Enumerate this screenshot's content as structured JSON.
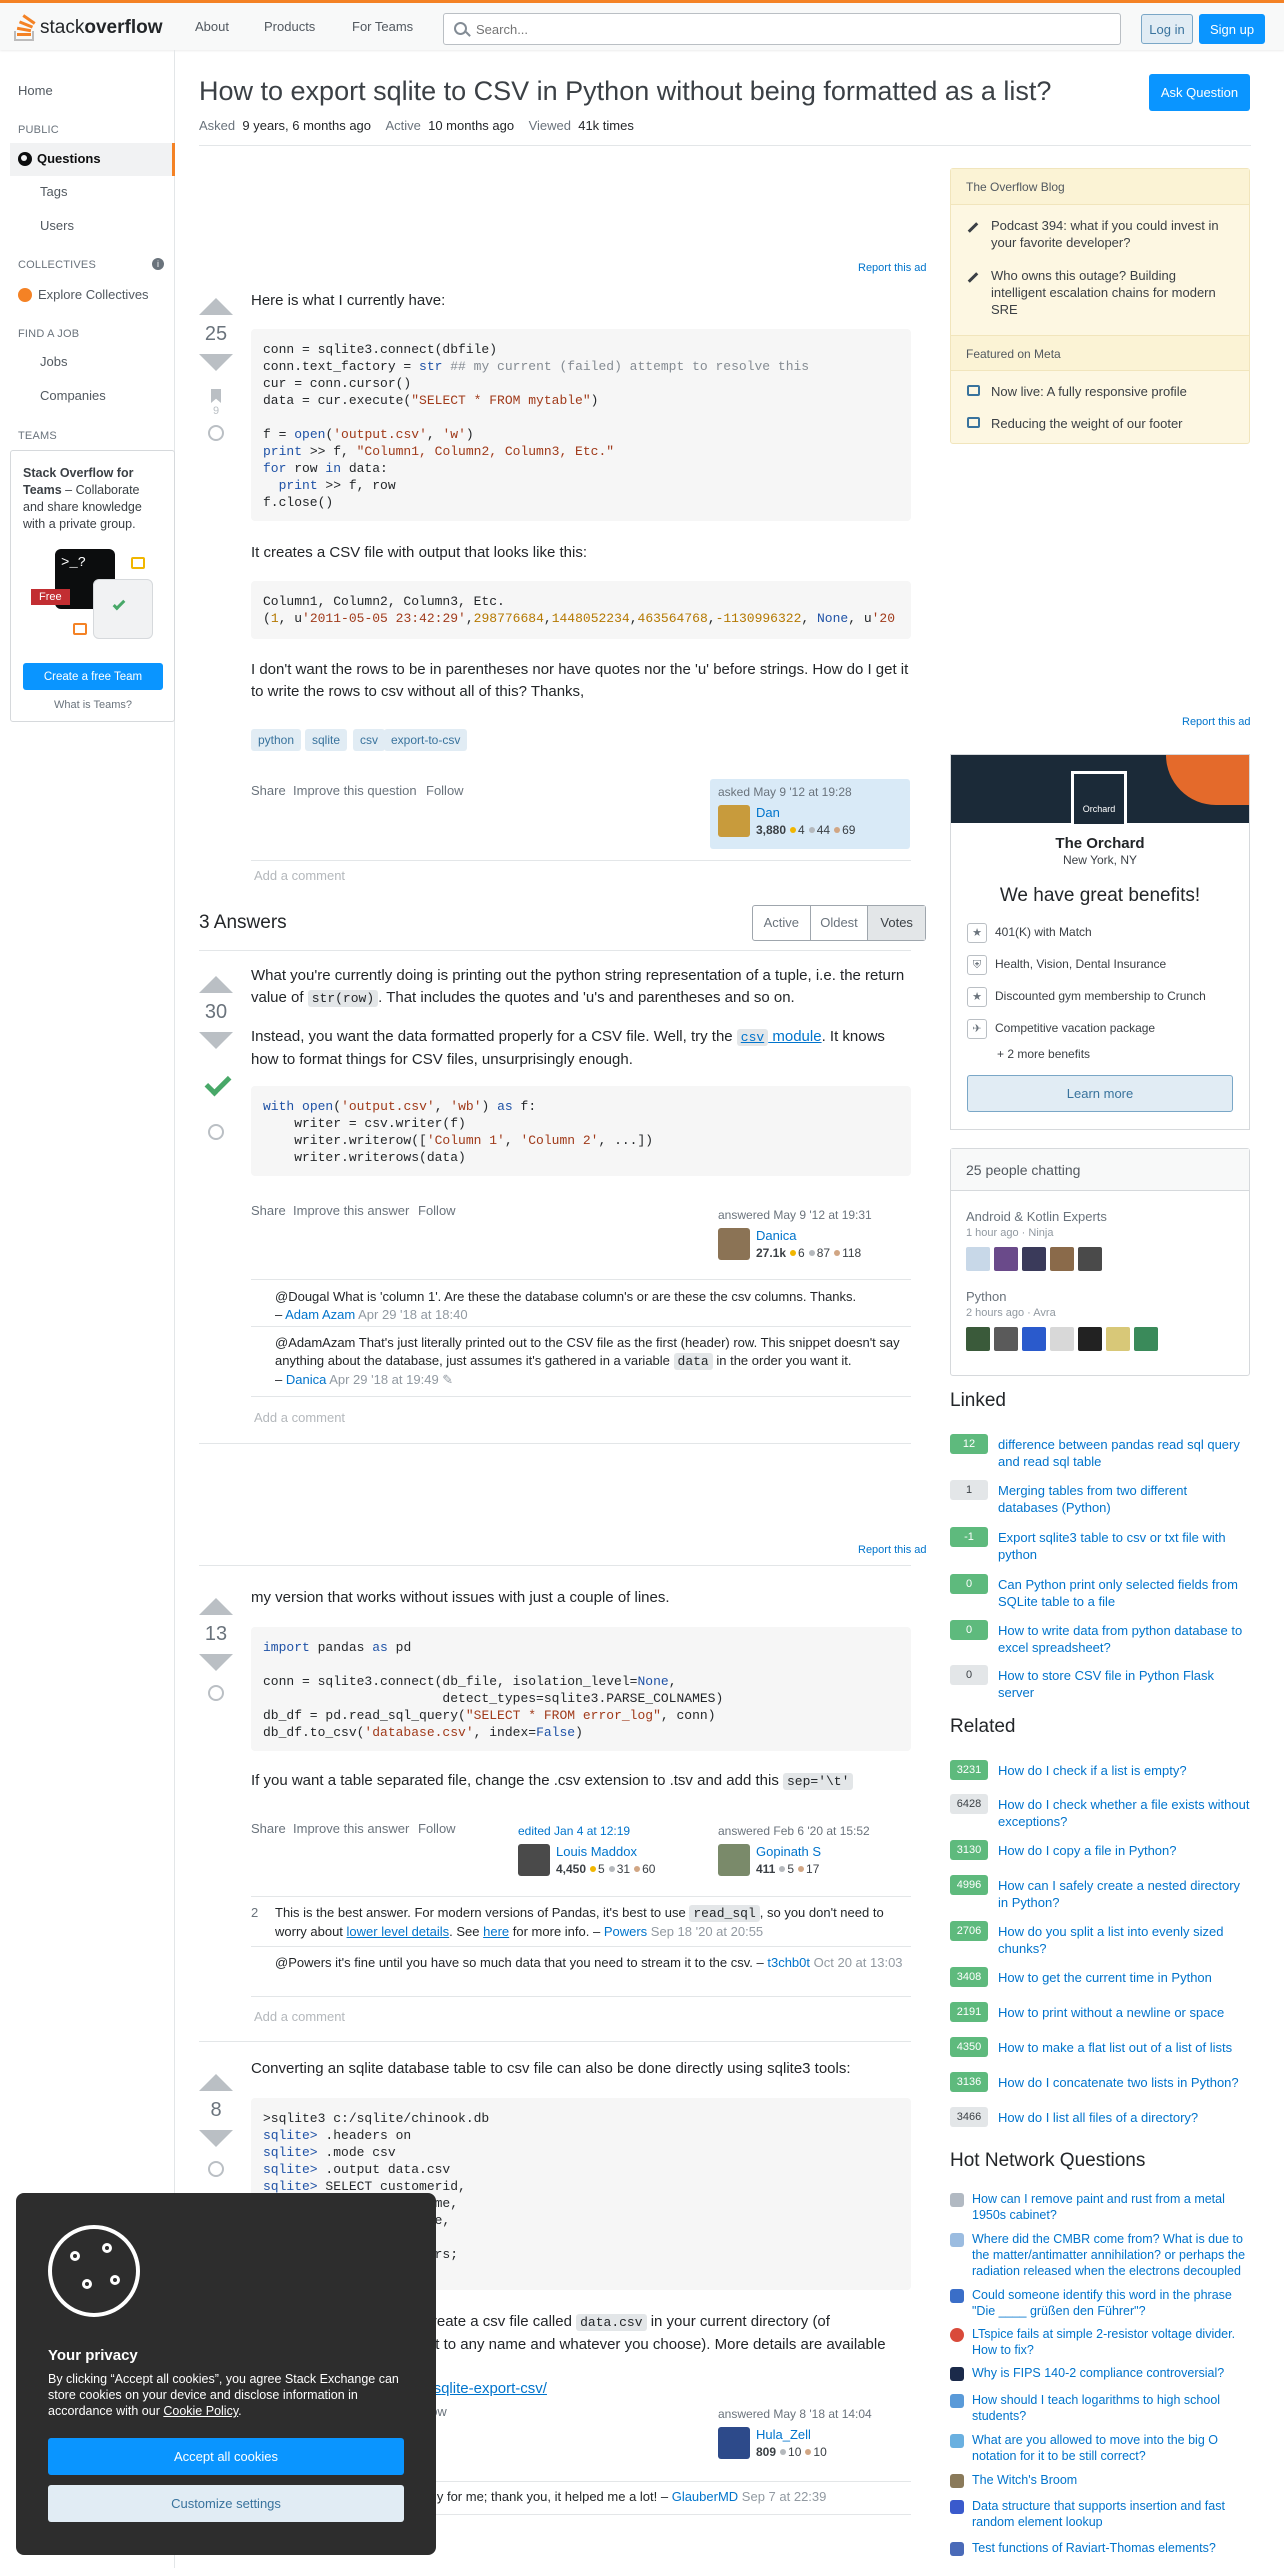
{
  "header": {
    "logo_text": "stack",
    "logo_bold": "overflow",
    "nav": [
      "About",
      "Products",
      "For Teams"
    ],
    "search_placeholder": "Search...",
    "login": "Log in",
    "signup": "Sign up"
  },
  "sidebar": {
    "home": "Home",
    "public": "PUBLIC",
    "questions": "Questions",
    "tags": "Tags",
    "users": "Users",
    "collectives": "COLLECTIVES",
    "explore": "Explore Collectives",
    "findajob": "FIND A JOB",
    "jobs": "Jobs",
    "companies": "Companies",
    "teams": "TEAMS",
    "teams_title": "Stack Overflow for Teams",
    "teams_desc": " – Collaborate and share knowledge with a private group.",
    "free": "Free",
    "create_team": "Create a free Team",
    "what_is": "What is Teams?"
  },
  "question": {
    "title": "How to export sqlite to CSV in Python without being formatted as a list?",
    "ask_button": "Ask Question",
    "asked_label": "Asked",
    "asked": "9 years, 6 months ago",
    "active_label": "Active",
    "active": "10 months ago",
    "viewed_label": "Viewed",
    "viewed": "41k times",
    "votes": "25",
    "bookmarks": "9",
    "intro": "Here is what I currently have:",
    "mid": "It creates a CSV file with output that looks like this:",
    "outro": "I don't want the rows to be in parentheses nor have quotes nor the 'u' before strings. How do I get it to write the rows to csv without all of this? Thanks,",
    "tags": [
      "python",
      "sqlite",
      "csv",
      "export-to-csv"
    ],
    "menu": [
      "Share",
      "Improve this question",
      "Follow"
    ],
    "asked_sig": "asked May 9 '12 at 19:28",
    "user": "Dan",
    "rep": "3,880",
    "gold": "4",
    "silver": "44",
    "bronze": "69",
    "add_comment": "Add a comment"
  },
  "report_ad": "Report this ad",
  "answers_header": "3 Answers",
  "sort": [
    "Active",
    "Oldest",
    "Votes"
  ],
  "a1": {
    "votes": "30",
    "p1a": "What you're currently doing is printing out the python string representation of a tuple, i.e. the return value of ",
    "p1code": "str(row)",
    "p1b": ". That includes the quotes and 'u's and parentheses and so on.",
    "p2a": "Instead, you want the data formatted properly for a CSV file. Well, try the ",
    "p2code": "csv",
    "p2link": " module",
    "p2b": ". It knows how to format things for CSV files, unsurprisingly enough.",
    "menu": [
      "Share",
      "Improve this answer",
      "Follow"
    ],
    "answered": "answered May 9 '12 at 19:31",
    "user": "Danica",
    "rep": "27.1k",
    "gold": "6",
    "silver": "87",
    "bronze": "118",
    "c1": "@Dougal What is 'column 1'. Are these the database column's or are these the csv columns. Thanks.",
    "c1u": "Adam Azam",
    "c1d": "Apr 29 '18 at 18:40",
    "c2a": "@AdamAzam That's just literally printed out to the CSV file as the first (header) row. This snippet doesn't say anything about the database, just assumes it's gathered in a variable ",
    "c2code": "data",
    "c2b": " in the order you want it.",
    "c2u": "Danica",
    "c2d": "Apr 29 '18 at 19:49",
    "add_comment": "Add a comment"
  },
  "a2": {
    "votes": "13",
    "p1": "my version that works without issues with just a couple of lines.",
    "p2a": "If you want a table separated file, change the .csv extension to .tsv and add this ",
    "p2code": "sep='\\t'",
    "menu": [
      "Share",
      "Improve this answer",
      "Follow"
    ],
    "edited": "edited Jan 4 at 12:19",
    "editor": "Louis Maddox",
    "erep": "4,450",
    "eg": "5",
    "es": "31",
    "eb": "60",
    "answered": "answered Feb 6 '20 at 15:52",
    "user": "Gopinath S",
    "rep": "411",
    "silver": "5",
    "bronze": "17",
    "c1score": "2",
    "c1a": "This is the best answer. For modern versions of Pandas, it's best to use ",
    "c1code": "read_sql",
    "c1b": ", so you don't need to worry about ",
    "c1link": "lower level details",
    "c1c": ". See ",
    "c1link2": "here",
    "c1d2": " for more info. – ",
    "c1u": "Powers",
    "c1d": "Sep 18 '20 at 20:55",
    "c2": "@Powers it's fine until you have so much data that you need to stream it to the csv. – ",
    "c2u": "t3chb0t",
    "c2d": "Oct 20 at 13:03",
    "add_comment": "Add a comment"
  },
  "a3": {
    "votes": "8",
    "p1": "Converting an sqlite database table to csv file can also be done directly using sqlite3 tools:",
    "p2a": "s will will create a csv file called ",
    "p2code": "data.csv",
    "p2b": " in your current directory (of",
    "p2c": "d whatever you choose). More details are available here:",
    "p2link": "qlite-export-csv/",
    "menu": "ow",
    "answered": "answered May 8 '18 at 14:04",
    "user": "Hula_Zell",
    "rep": "809",
    "silver": "10",
    "bronze": "10",
    "c1": "me; thank you, it helped me a lot! – ",
    "c1u": "GlauberMD",
    "c1d": "Sep 7 at 22:39"
  },
  "blog": {
    "header": "The Overflow Blog",
    "i1": "Podcast 394: what if you could invest in your favorite developer?",
    "i2": "Who owns this outage? Building intelligent escalation chains for modern SRE",
    "meta": "Featured on Meta",
    "m1": "Now live: A fully responsive profile",
    "m2": "Reducing the weight of our footer"
  },
  "ad": {
    "logo": "Orchard",
    "company": "The Orchard",
    "location": "New York, NY",
    "headline": "We have great benefits!",
    "benefits": [
      "401(K) with Match",
      "Health, Vision, Dental Insurance",
      "Discounted gym membership to Crunch",
      "Competitive vacation package"
    ],
    "more": "+ 2 more benefits",
    "learn": "Learn more"
  },
  "chat": {
    "header": "25 people chatting",
    "r1": "Android & Kotlin Experts",
    "r1t": "1 hour ago",
    "r1u": "Ninja",
    "r2": "Python",
    "r2t": "2 hours ago",
    "r2u": "Avra"
  },
  "linked": {
    "title": "Linked",
    "items": [
      {
        "score": "12",
        "text": "difference between pandas read sql query and read sql table"
      },
      {
        "score": "1",
        "text": "Merging tables from two different databases (Python)"
      },
      {
        "score": "-1",
        "text": "Export sqlite3 table to csv or txt file with python"
      },
      {
        "score": "0",
        "text": "Can Python print only selected fields from SQLite table to a file"
      },
      {
        "score": "0",
        "text": "How to write data from python database to excel spreadsheet?"
      },
      {
        "score": "0",
        "text": "How to store CSV file in Python Flask server"
      }
    ]
  },
  "related": {
    "title": "Related",
    "items": [
      {
        "score": "3231",
        "text": "How do I check if a list is empty?"
      },
      {
        "score": "6428",
        "text": "How do I check whether a file exists without exceptions?"
      },
      {
        "score": "3130",
        "text": "How do I copy a file in Python?"
      },
      {
        "score": "4996",
        "text": "How can I safely create a nested directory in Python?"
      },
      {
        "score": "2706",
        "text": "How do you split a list into evenly sized chunks?"
      },
      {
        "score": "3408",
        "text": "How to get the current time in Python"
      },
      {
        "score": "2191",
        "text": "How to print without a newline or space"
      },
      {
        "score": "4350",
        "text": "How to make a flat list out of a list of lists"
      },
      {
        "score": "3136",
        "text": "How do I concatenate two lists in Python?"
      },
      {
        "score": "3466",
        "text": "How do I list all files of a directory?"
      }
    ]
  },
  "hnq": {
    "title": "Hot Network Questions",
    "items": [
      "How can I remove paint and rust from a metal 1950s cabinet?",
      "Where did the CMBR come from? What is due to the matter/antimatter annihilation? or perhaps the radiation released when the electrons decoupled",
      "Could someone identify this word in the phrase \"Die ____ grüßen den Führer\"?",
      "LTspice fails at simple 2-resistor voltage divider. How to fix?",
      "Why is FIPS 140-2 compliance controversial?",
      "How should I teach logarithms to high school students?",
      "What are you allowed to move into the big O notation for it to be still correct?",
      "The Witch's Broom",
      "Data structure that supports insertion and fast random element lookup",
      "Test functions of Raviart-Thomas elements?"
    ]
  },
  "cookie": {
    "title": "Your privacy",
    "text": "By clicking “Accept all cookies”, you agree Stack Exchange can store cookies on your device and disclose information in accordance with our ",
    "link": "Cookie Policy",
    "accept": "Accept all cookies",
    "customize": "Customize settings"
  }
}
